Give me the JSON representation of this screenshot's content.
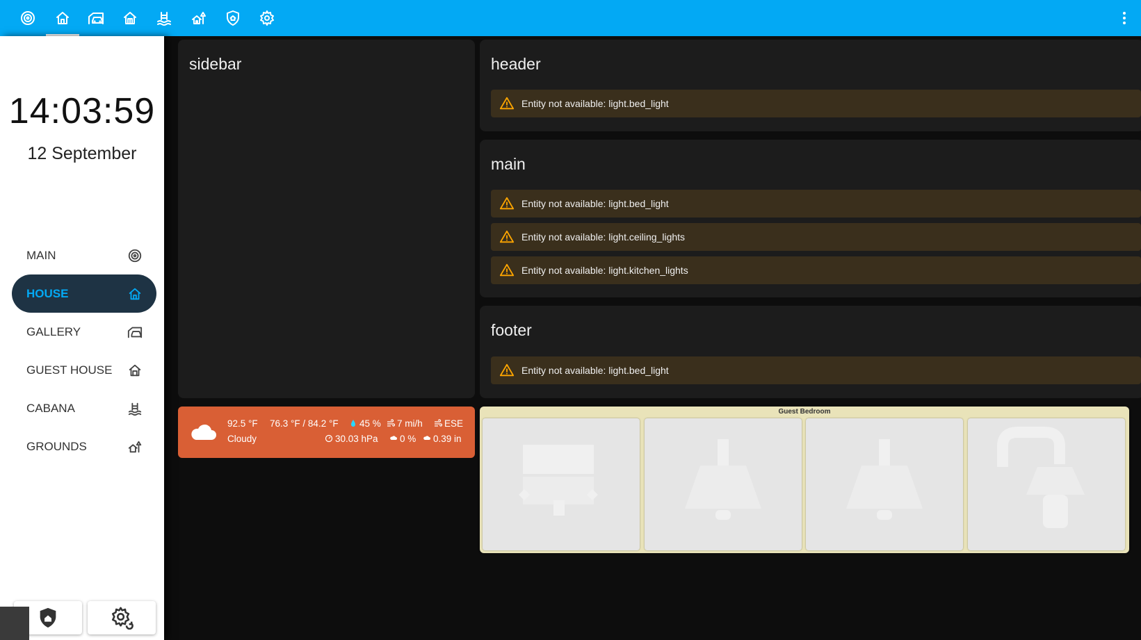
{
  "topbar": {
    "tabs": [
      {
        "icon": "target-icon",
        "name": "main"
      },
      {
        "icon": "home-icon",
        "name": "house",
        "active": true
      },
      {
        "icon": "car-garage-icon",
        "name": "gallery"
      },
      {
        "icon": "guest-house-icon",
        "name": "guest-house"
      },
      {
        "icon": "pool-icon",
        "name": "cabana"
      },
      {
        "icon": "grounds-icon",
        "name": "grounds"
      },
      {
        "icon": "shield-home-icon",
        "name": "security"
      },
      {
        "icon": "settings-icon",
        "name": "settings"
      }
    ],
    "menu_icon": "dots-vertical-icon"
  },
  "sidebar": {
    "clock": "14:03:59",
    "date": "12 September",
    "items": [
      {
        "label": "MAIN",
        "icon": "target-icon"
      },
      {
        "label": "HOUSE",
        "icon": "home-icon",
        "active": true
      },
      {
        "label": "GALLERY",
        "icon": "car-garage-icon"
      },
      {
        "label": "GUEST HOUSE",
        "icon": "guest-house-icon"
      },
      {
        "label": "CABANA",
        "icon": "pool-icon"
      },
      {
        "label": "GROUNDS",
        "icon": "grounds-icon"
      }
    ],
    "bottom_buttons": [
      {
        "icon": "shield-home-icon"
      },
      {
        "icon": "settings-icon"
      }
    ]
  },
  "cards": {
    "sidebar": {
      "title": "sidebar"
    },
    "header": {
      "title": "header",
      "warnings": [
        "Entity not available: light.bed_light"
      ]
    },
    "main": {
      "title": "main",
      "warnings": [
        "Entity not available: light.bed_light",
        "Entity not available: light.ceiling_lights",
        "Entity not available: light.kitchen_lights"
      ]
    },
    "footer": {
      "title": "footer",
      "warnings": [
        "Entity not available: light.bed_light"
      ]
    }
  },
  "weather": {
    "temperature": "92.5 °F",
    "condition": "Cloudy",
    "temp_range": "76.3 °F / 84.2 °F",
    "humidity": "45 %",
    "wind_speed": "7 mi/h",
    "wind_direction": "ESE",
    "pressure": "30.03 hPa",
    "precip_probability": "0 %",
    "precipitation": "0.39 in",
    "accent_color": "#d95f35"
  },
  "room": {
    "title": "Guest Bedroom",
    "tiles": [
      {
        "icon": "tv-icon"
      },
      {
        "icon": "ceiling-lamp-icon"
      },
      {
        "icon": "ceiling-lamp-icon"
      },
      {
        "icon": "desk-lamp-icon"
      }
    ]
  },
  "colors": {
    "primary": "#03a9f4",
    "active_nav_bg": "#1e3344",
    "warning": "#ffa600"
  }
}
